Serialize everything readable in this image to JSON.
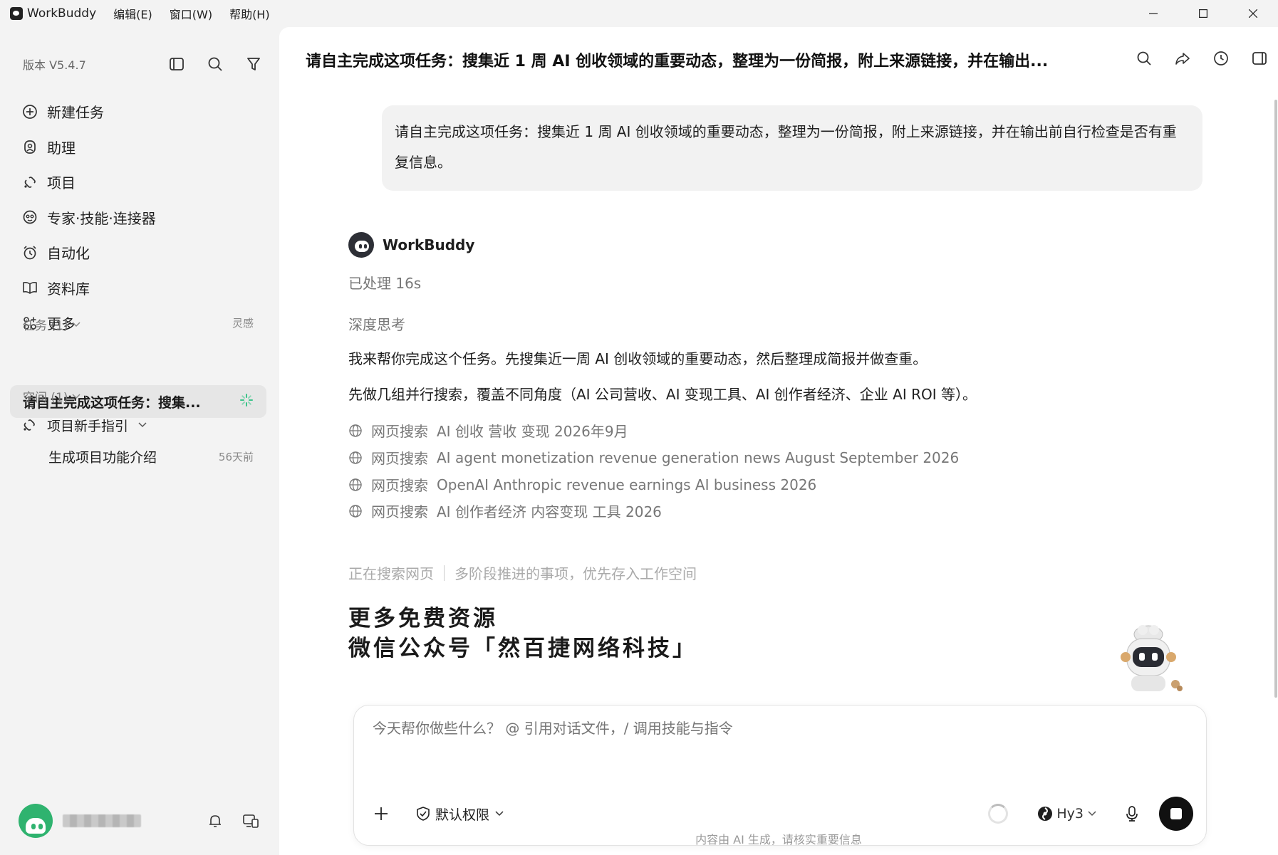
{
  "titlebar": {
    "app_name": "WorkBuddy",
    "menus": [
      "编辑(E)",
      "窗口(W)",
      "帮助(H)"
    ]
  },
  "sidebar": {
    "version": "版本 V5.4.7",
    "nav": [
      {
        "label": "新建任务",
        "icon": "plus-circle-icon"
      },
      {
        "label": "助理",
        "icon": "assistant-icon"
      },
      {
        "label": "项目",
        "icon": "project-icon"
      },
      {
        "label": "专家·技能·连接器",
        "icon": "expert-icon"
      },
      {
        "label": "自动化",
        "icon": "automation-icon"
      },
      {
        "label": "资料库",
        "icon": "book-icon"
      },
      {
        "label": "更多",
        "icon": "grid-icon",
        "hint": "灵感"
      }
    ],
    "tasks_header": "任务 (1)",
    "active_task": "请自主完成这项任务：搜集...",
    "spaces_header": "空间 (1)",
    "space_project": "项目新手指引",
    "space_subitem": "生成项目功能介绍",
    "space_subitem_time": "56天前"
  },
  "conversation": {
    "title": "请自主完成这项任务：搜集近 1 周 AI 创收领域的重要动态，整理为一份简报，附上来源链接，并在输出...",
    "user_message": "请自主完成这项任务：搜集近 1 周 AI 创收领域的重要动态，整理为一份简报，附上来源链接，并在输出前自行检查是否有重复信息。",
    "assistant_name": "WorkBuddy",
    "processed": "已处理 16s",
    "deep_think": "深度思考",
    "para1": "我来帮你完成这个任务。先搜集近一周 AI 创收领域的重要动态，然后整理成简报并做查重。",
    "para2": "先做几组并行搜索，覆盖不同角度（AI 公司营收、AI 变现工具、AI 创作者经济、企业 AI ROI 等）。",
    "search_label": "网页搜索",
    "searches": [
      "AI 创收 营收 变现 2026年9月",
      "AI agent monetization revenue generation news August September 2026",
      "OpenAI Anthropic revenue earnings AI business 2026",
      "AI 创作者经济 内容变现 工具 2026"
    ],
    "status_left": "正在搜索网页",
    "status_right": "多阶段推进的事项，优先存入工作空间",
    "promo_line1": "更多免费资源",
    "promo_line2": "微信公众号「然百捷网络科技」"
  },
  "composer": {
    "placeholder": "今天帮你做些什么？ @ 引用对话文件，/ 调用技能与指令",
    "permission": "默认权限",
    "model": "Hy3"
  },
  "footer_note": "内容由 AI 生成，请核实重要信息"
}
